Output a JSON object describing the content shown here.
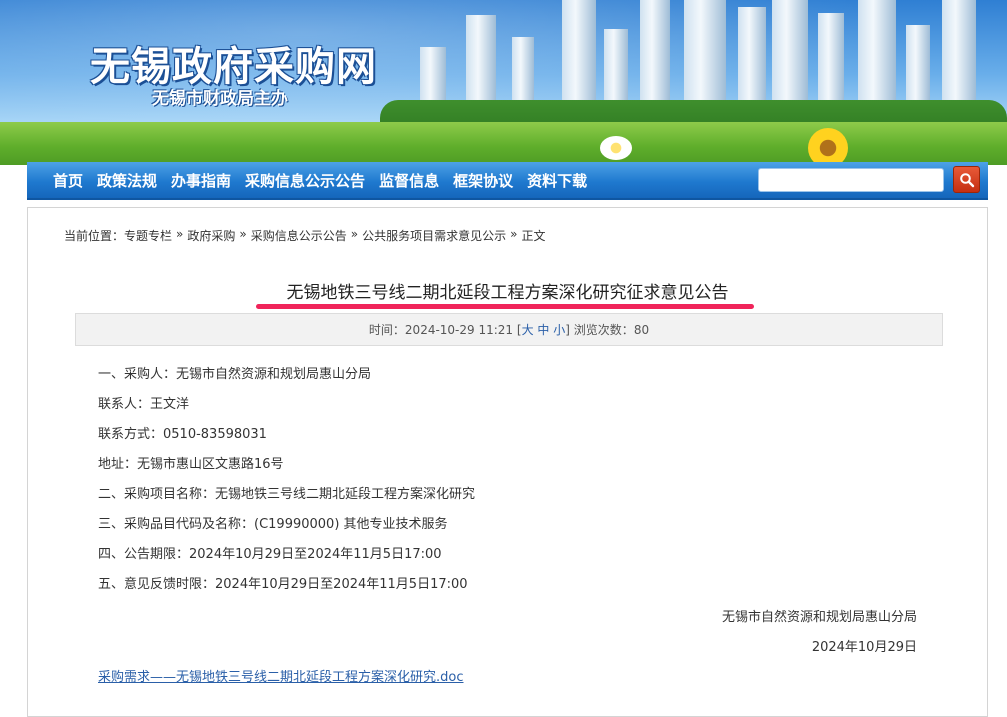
{
  "header": {
    "site_title": "无锡政府采购网",
    "site_subtitle": "无锡市财政局主办"
  },
  "nav": {
    "items": [
      "首页",
      "政策法规",
      "办事指南",
      "采购信息公示公告",
      "监督信息",
      "框架协议",
      "资料下载"
    ],
    "search_placeholder": "",
    "accent_color": "#1f79cf"
  },
  "breadcrumb": {
    "prefix": "当前位置：",
    "items": [
      "专题专栏",
      "政府采购",
      "采购信息公示公告",
      "公共服务项目需求意见公示",
      "正文"
    ],
    "separator": "»"
  },
  "article": {
    "title": "无锡地铁三号线二期北延段工程方案深化研究征求意见公告",
    "meta": {
      "time_label": "时间：",
      "time": "2024-10-29 11:21",
      "size_open": "[",
      "size_large": "大",
      "size_medium": "中",
      "size_small": "小",
      "size_close": "]",
      "views_label": "浏览次数：",
      "views": "80"
    },
    "lines": [
      "一、采购人：无锡市自然资源和规划局惠山分局",
      "联系人：王文洋",
      "联系方式：0510-83598031",
      "地址：无锡市惠山区文惠路16号",
      "二、采购项目名称：无锡地铁三号线二期北延段工程方案深化研究",
      "三、采购品目代码及名称：(C19990000) 其他专业技术服务",
      "四、公告期限：2024年10月29日至2024年11月5日17:00",
      "五、意见反馈时限：2024年10月29日至2024年11月5日17:00"
    ],
    "signature_org": "无锡市自然资源和规划局惠山分局",
    "signature_date": "2024年10月29日",
    "attachment": "采购需求——无锡地铁三号线二期北延段工程方案深化研究.doc",
    "highlight_color": "#f0245a"
  }
}
